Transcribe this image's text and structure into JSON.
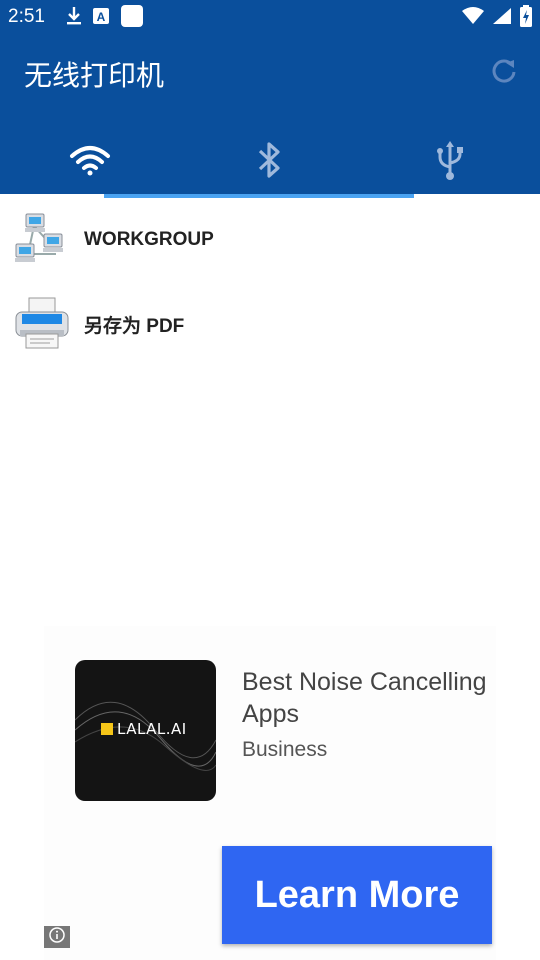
{
  "status_bar": {
    "time": "2:51",
    "icons": [
      "download-icon",
      "text-a-icon",
      "app-square-icon",
      "wifi-icon",
      "cell-signal-icon",
      "battery-charging-icon"
    ]
  },
  "app_bar": {
    "title": "无线打印机",
    "refresh_icon": "refresh-icon",
    "color": "#0a4f9c",
    "tabs": [
      {
        "name": "wifi",
        "icon": "wifi-icon"
      },
      {
        "name": "bluetooth",
        "icon": "bluetooth-icon"
      },
      {
        "name": "usb",
        "icon": "usb-icon"
      }
    ],
    "selected_tab": "wifi"
  },
  "printers": [
    {
      "label": "WORKGROUP",
      "icon": "network-computers-icon"
    },
    {
      "label": "另存为 PDF",
      "icon": "printer-icon"
    }
  ],
  "ad": {
    "brand": "LALAL.AI",
    "title": "Best Noise Cancelling Apps",
    "category": "Business",
    "cta": "Learn More",
    "cta_color": "#2f66f2",
    "info_icon": "info-icon"
  }
}
